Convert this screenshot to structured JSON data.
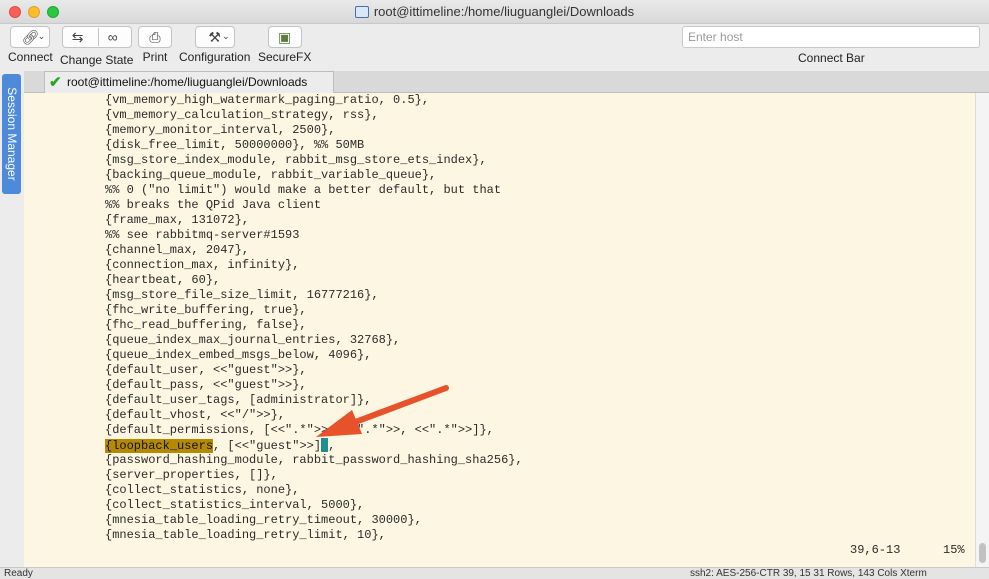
{
  "window": {
    "title": "root@ittimeline:/home/liuguanglei/Downloads"
  },
  "toolbar": {
    "connect": "Connect",
    "change_state": "Change State",
    "print": "Print",
    "configuration": "Configuration",
    "securefx": "SecureFX",
    "host_placeholder": "Enter host",
    "connect_bar": "Connect Bar"
  },
  "side_tab": "Session Manager",
  "tab": {
    "label": "root@ittimeline:/home/liuguanglei/Downloads"
  },
  "terminal": {
    "lines": [
      "{vm_memory_high_watermark_paging_ratio, 0.5},",
      "{vm_memory_calculation_strategy, rss},",
      "{memory_monitor_interval, 2500},",
      "{disk_free_limit, 50000000}, %% 50MB",
      "{msg_store_index_module, rabbit_msg_store_ets_index},",
      "{backing_queue_module, rabbit_variable_queue},",
      "%% 0 (\"no limit\") would make a better default, but that",
      "%% breaks the QPid Java client",
      "{frame_max, 131072},",
      "%% see rabbitmq-server#1593",
      "{channel_max, 2047},",
      "{connection_max, infinity},",
      "{heartbeat, 60},",
      "{msg_store_file_size_limit, 16777216},",
      "{fhc_write_buffering, true},",
      "{fhc_read_buffering, false},",
      "{queue_index_max_journal_entries, 32768},",
      "{queue_index_embed_msgs_below, 4096},",
      "{default_user, <<\"guest\">>},",
      "{default_pass, <<\"guest\">>},",
      "{default_user_tags, [administrator]},",
      "{default_vhost, <<\"/\">>},",
      "{default_permissions, [<<\".*\">>, <<\".*\">>, <<\".*\">>]},"
    ],
    "highlight_line": {
      "prefix": "{",
      "highlighted": "loopback_users",
      "rest": ", [<<\"guest\">>]",
      "suffix": ","
    },
    "lines_after": [
      "{password_hashing_module, rabbit_password_hashing_sha256},",
      "{server_properties, []},",
      "{collect_statistics, none},",
      "{collect_statistics_interval, 5000},",
      "{mnesia_table_loading_retry_timeout, 30000},",
      "{mnesia_table_loading_retry_limit, 10},"
    ],
    "position": "39,6-13",
    "percent": "15%"
  },
  "statusbar": {
    "left": "Ready",
    "right": "ssh2: AES-256-CTR   39, 15   31 Rows, 143 Cols   Xterm"
  },
  "colors": {
    "terminal_bg": "#fdf6e2",
    "highlight": "#b58a00",
    "cursor": "#1f8f8f",
    "arrow": "#e8522a"
  }
}
